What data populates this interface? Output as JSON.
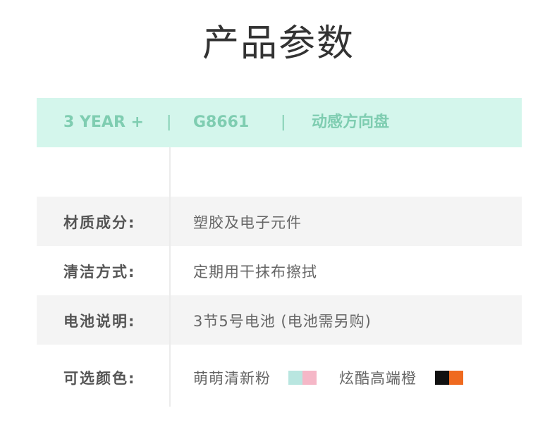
{
  "title": "产品参数",
  "header": {
    "age": "3 YEAR +",
    "separator": "|",
    "model": "G8661",
    "name": "动感方向盘"
  },
  "rows": [
    {
      "label": "",
      "value": ""
    },
    {
      "label": "材质成分:",
      "value": "塑胶及电子元件"
    },
    {
      "label": "清洁方式:",
      "value": "定期用干抹布擦拭"
    },
    {
      "label": "电池说明:",
      "value": "3节5号电池 (电池需另购)"
    },
    {
      "label": "可选颜色:",
      "colors": [
        {
          "name": "萌萌清新粉",
          "swatches": [
            "#b9e6e0",
            "#f5b7c7"
          ]
        },
        {
          "name": "炫酷高端橙",
          "swatches": [
            "#111111",
            "#ef6a1f"
          ]
        }
      ]
    }
  ],
  "colors": {
    "header_bg": "#d4f6ec",
    "header_text": "#7fcdb1",
    "row_alt_bg": "#f4f4f4"
  }
}
